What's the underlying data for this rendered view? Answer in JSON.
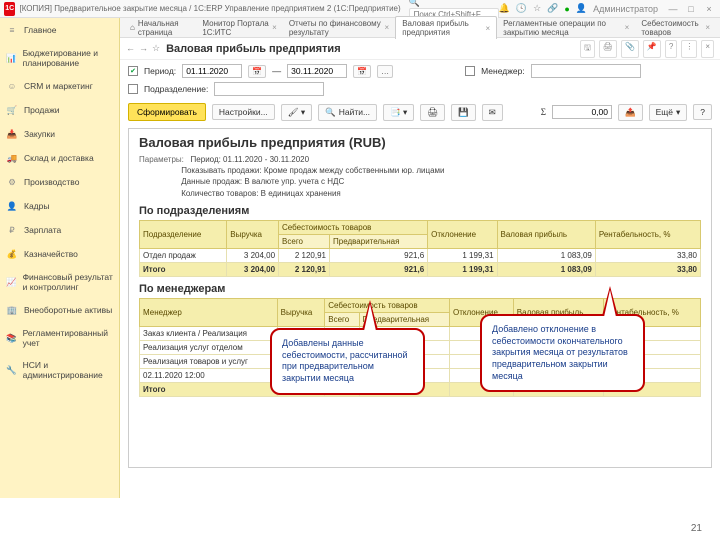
{
  "titlebar": {
    "app_title": "[КОПИЯ] Предварительное закрытие месяца / 1С:ERP Управление предприятием 2  (1С:Предприятие)",
    "search_placeholder": "Поиск Ctrl+Shift+F",
    "user": "Администратор"
  },
  "sidebar": {
    "items": [
      {
        "icon": "≡",
        "label": "Главное"
      },
      {
        "icon": "📊",
        "label": "Бюджетирование и планирование"
      },
      {
        "icon": "☺",
        "label": "CRM и маркетинг"
      },
      {
        "icon": "🛒",
        "label": "Продажи"
      },
      {
        "icon": "📥",
        "label": "Закупки"
      },
      {
        "icon": "🚚",
        "label": "Склад и доставка"
      },
      {
        "icon": "⚙",
        "label": "Производство"
      },
      {
        "icon": "👤",
        "label": "Кадры"
      },
      {
        "icon": "₽",
        "label": "Зарплата"
      },
      {
        "icon": "💰",
        "label": "Казначейство"
      },
      {
        "icon": "📈",
        "label": "Финансовый результат и контроллинг"
      },
      {
        "icon": "🏢",
        "label": "Внеоборотные активы"
      },
      {
        "icon": "📚",
        "label": "Регламентированный учет"
      },
      {
        "icon": "🔧",
        "label": "НСИ и администрирование"
      }
    ]
  },
  "tabs": [
    {
      "label": "Начальная страница"
    },
    {
      "label": "Монитор Портала 1С:ИТС"
    },
    {
      "label": "Отчеты по финансовому результату"
    },
    {
      "label": "Валовая прибыль предприятия",
      "active": true
    },
    {
      "label": "Регламентные операции по закрытию месяца"
    },
    {
      "label": "Себестоимость товаров"
    }
  ],
  "page": {
    "title": "Валовая прибыль предприятия"
  },
  "toolbar_right": {
    "more": "Ещё"
  },
  "filters": {
    "period_label": "Период:",
    "period_from": "01.11.2020",
    "period_to": "30.11.2020",
    "manager_label": "Менеджер:",
    "subdivision_label": "Подразделение:"
  },
  "actions": {
    "form": "Сформировать",
    "settings": "Настройки...",
    "find": "Найти...",
    "sigma": "Σ",
    "sum": "0,00"
  },
  "report": {
    "title": "Валовая прибыль предприятия (RUB)",
    "params_label": "Параметры:",
    "p1": "Период: 01.11.2020 - 30.11.2020",
    "p2": "Показывать продажи: Кроме продаж между собственными юр. лицами",
    "p3": "Данные продаж: В валюте упр. учета с НДС",
    "p4": "Количество товаров: В единицах хранения",
    "sec1": "По подразделениям",
    "sec2": "По менеджерам",
    "h_sub": "Подразделение",
    "h_mgr": "Менеджер",
    "h_rev": "Выручка",
    "h_cost": "Себестоимость товаров",
    "h_cost_total": "Всего",
    "h_cost_prelim": "Предварительная",
    "h_dev": "Отклонение",
    "h_gross": "Валовая прибыль",
    "h_rent": "Рентабельность, %",
    "row1": {
      "name": "Отдел продаж",
      "rev": "3 204,00",
      "cost_t": "2 120,91",
      "cost_p": "921,6",
      "dev": "1 199,31",
      "gross": "1 083,09",
      "rent": "33,80"
    },
    "tot1": {
      "name": "Итого",
      "rev": "3 204,00",
      "cev": "2 120,91",
      "cpp": "921,6",
      "dev": "1 199,31",
      "gross": "1 083,09",
      "rent": "33,80"
    },
    "m_row1": {
      "name": "Заказ клиента / Реализация"
    },
    "m_row2": {
      "name": "Реализация услуг отделом"
    },
    "m_row3": {
      "name": "Реализация товаров и услуг"
    },
    "m_row4": {
      "name": "02.11.2020 12:00"
    },
    "m_tot": {
      "name": "Итого"
    }
  },
  "callouts": {
    "c1": "Добавлены данные себестоимости, рассчитанной при предварительном закрытии месяца",
    "c2": "Добавлено отклонение в себестоимости окончательного закрытия месяца от результатов предварительном закрытии месяца"
  },
  "page_number": "21"
}
